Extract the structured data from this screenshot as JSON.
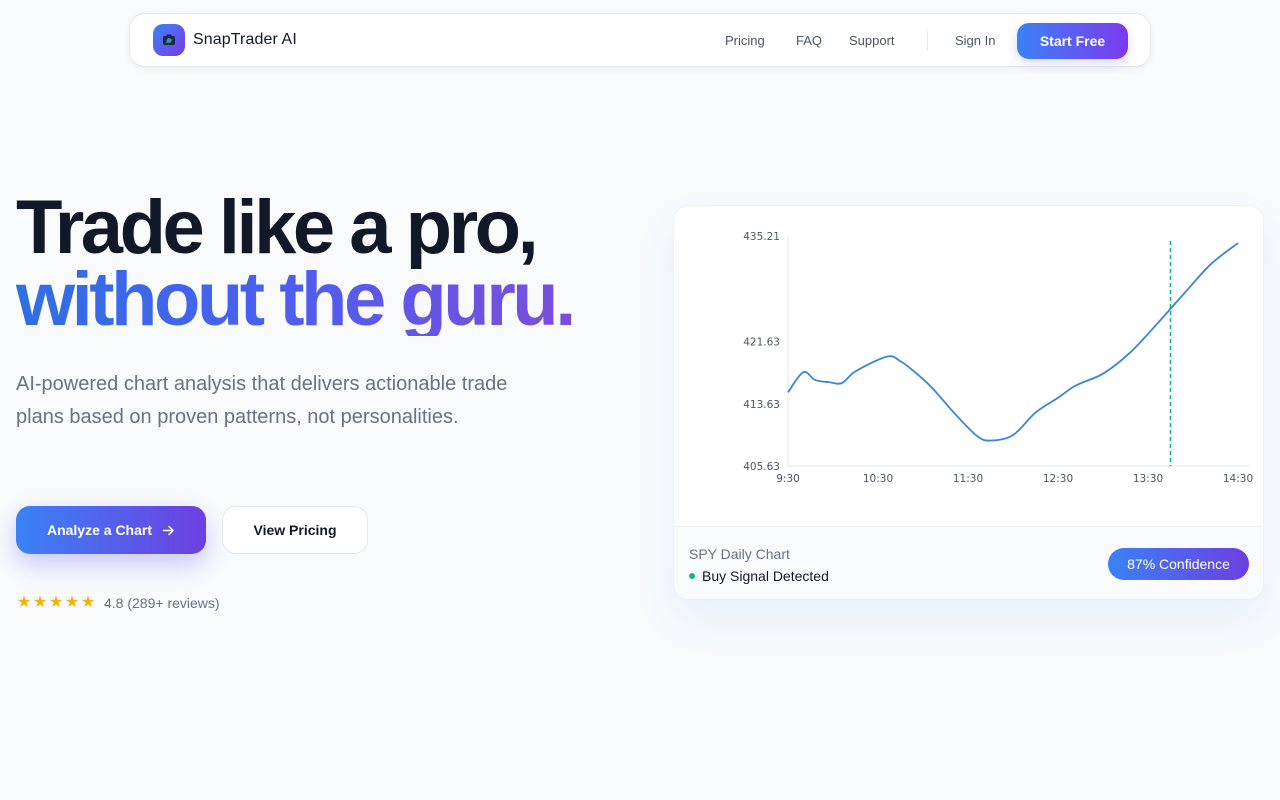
{
  "brand": {
    "name": "SnapTrader AI",
    "logo_icon": "camera-icon"
  },
  "nav": {
    "links": [
      "Pricing",
      "FAQ",
      "Support"
    ],
    "sign_in": "Sign In",
    "start_free": "Start Free"
  },
  "hero": {
    "line1": "Trade like a pro,",
    "line2": "without the guru.",
    "subtitle": "AI-powered chart analysis that delivers actionable trade plans based on proven patterns, not personalities.",
    "primary_cta": "Analyze a Chart",
    "primary_cta_icon": "arrow-right-icon",
    "secondary_cta": "View Pricing"
  },
  "rating": {
    "stars": 5,
    "text": "4.8 (289+ reviews)",
    "star_color": "#f5b301"
  },
  "card": {
    "chart_name": "SPY Daily Chart",
    "signal_text": "Buy Signal Detected",
    "signal_color": "#10b981",
    "confidence": "87% Confidence"
  },
  "colors": {
    "accent_start": "#3b82f6",
    "accent_end": "#7c3aed",
    "line": "#3a84dc",
    "signal_line": "#10b981"
  },
  "chart_data": {
    "type": "line",
    "x_labels": [
      "9:30",
      "10:30",
      "11:30",
      "12:30",
      "13:30",
      "14:30"
    ],
    "x": [
      0,
      0.17,
      0.3,
      0.46,
      0.6,
      0.75,
      1.1,
      1.25,
      1.4,
      1.6,
      1.85,
      2.1,
      2.25,
      2.5,
      2.75,
      3.0,
      3.2,
      3.5,
      3.8,
      4.1,
      4.4,
      4.7,
      5.0
    ],
    "y": [
      415.1,
      417.7,
      416.7,
      416.4,
      416.3,
      417.8,
      419.7,
      419.1,
      417.8,
      415.7,
      412.4,
      409.5,
      408.9,
      409.6,
      412.5,
      414.4,
      416.0,
      417.5,
      420.2,
      423.9,
      427.8,
      431.6,
      434.3
    ],
    "yticks": [
      405.63,
      413.63,
      421.63,
      435.21
    ],
    "ylim": [
      405.63,
      435.21
    ],
    "xlim": [
      0,
      5
    ],
    "signal_x": 4.25,
    "grid": false
  }
}
